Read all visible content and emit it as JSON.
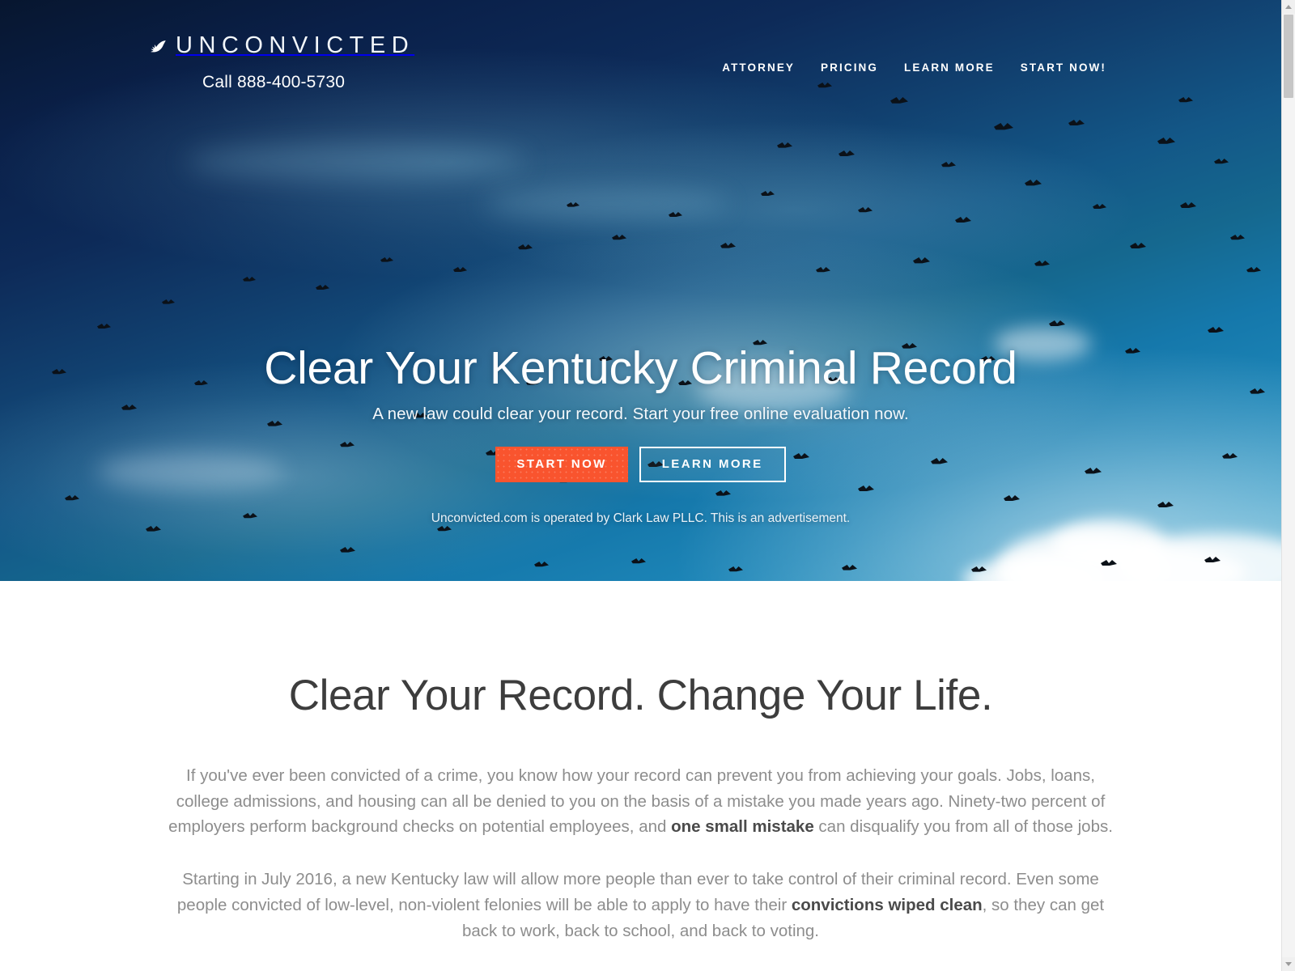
{
  "brand": {
    "icon": "bird-icon",
    "name": "UNCONVICTED",
    "phone": "Call 888-400-5730"
  },
  "nav": {
    "items": [
      {
        "label": "ATTORNEY"
      },
      {
        "label": "PRICING"
      },
      {
        "label": "LEARN MORE"
      },
      {
        "label": "START NOW!"
      }
    ]
  },
  "hero": {
    "title": "Clear Your Kentucky Criminal Record",
    "subtitle": "A new law could clear your record. Start your free online evaluation now.",
    "primary_cta": "START NOW",
    "secondary_cta": "LEARN MORE",
    "disclaimer": "Unconvicted.com is operated by Clark Law PLLC. This is an advertisement."
  },
  "section": {
    "title": "Clear Your Record. Change Your Life.",
    "paragraph1_part1": "If you've ever been convicted of a crime, you know how your record can prevent you from achieving your goals. Jobs, loans, college admissions, and housing can all be denied to you on the basis of a mistake you made years ago. Ninety-two percent of employers perform background checks on potential employees, and ",
    "paragraph1_bold": "one small mistake",
    "paragraph1_part2": " can disqualify you from all of those jobs.",
    "paragraph2_part1": "Starting in July 2016, a new Kentucky law will allow more people than ever to take control of their criminal record. Even some people convicted of low-level, non-violent felonies will be able to apply to have their ",
    "paragraph2_bold": "convictions wiped clean",
    "paragraph2_part2": ", so they can get back to work, back to school, and back to voting."
  },
  "colors": {
    "accent_orange": "#f9542e",
    "hero_dark_navy": "#0a2049",
    "hero_light_blue": "#1d86b8",
    "body_text": "#8d8d8d",
    "heading_text": "#3d3d3d"
  },
  "scrollbar": {
    "up_arrow": "scroll-up-arrow",
    "down_arrow": "scroll-down-arrow"
  }
}
